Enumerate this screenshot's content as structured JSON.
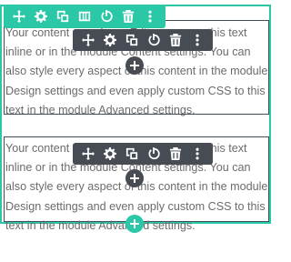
{
  "module_text": "Your content goes here. Edit or remove this text inline or in the module Content settings. You can also style every aspect of this content in the module Design settings and even apply custom CSS to this text in the module Advanced settings.",
  "colors": {
    "accent_green": "#2bc8a8",
    "toolbar_dark": "#474b54",
    "text_gray": "#6b6b6b",
    "module_border": "#3f4e58"
  },
  "section_toolbar": {
    "icons": [
      "move-icon",
      "settings-gear-icon",
      "duplicate-icon",
      "columns-icon",
      "power-icon",
      "trash-icon",
      "more-options-icon"
    ]
  },
  "module_toolbar": {
    "icons": [
      "move-icon",
      "settings-gear-icon",
      "duplicate-icon",
      "power-icon",
      "trash-icon",
      "more-options-icon"
    ]
  },
  "modules": [
    {
      "id": "module-1"
    },
    {
      "id": "module-2"
    }
  ]
}
